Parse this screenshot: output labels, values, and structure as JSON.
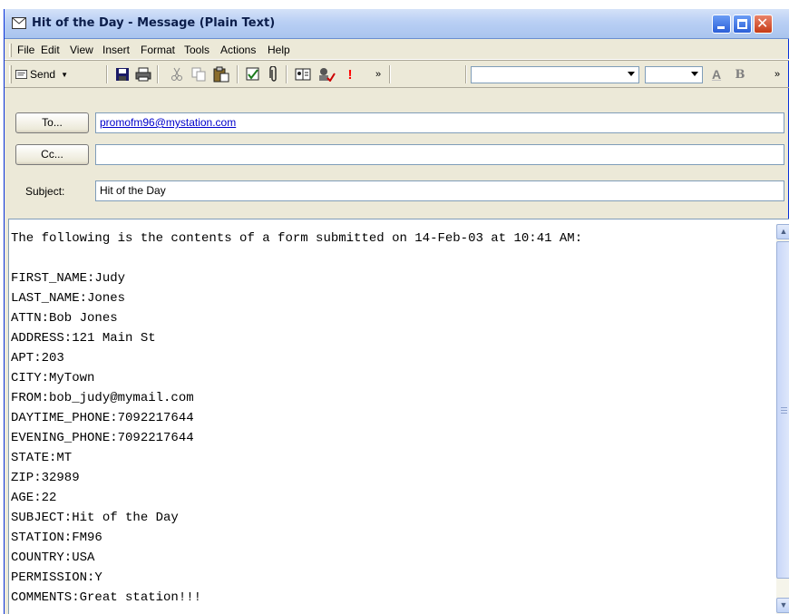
{
  "window": {
    "title": "Hit of the Day - Message (Plain Text)"
  },
  "menu": [
    {
      "label": "File"
    },
    {
      "label": "Edit"
    },
    {
      "label": "View"
    },
    {
      "label": "Insert"
    },
    {
      "label": "Format"
    },
    {
      "label": "Tools"
    },
    {
      "label": "Actions"
    },
    {
      "label": "Help"
    }
  ],
  "toolbar": {
    "send_label": "Send",
    "bold_label": "B",
    "font_color_label": "A",
    "importance_label": "!",
    "overflow_label": "»",
    "font_value": "",
    "size_value": ""
  },
  "header": {
    "to_button": "To...",
    "to_value": "promofm96@mystation.com",
    "cc_button": "Cc...",
    "cc_value": "",
    "subject_label": "Subject:",
    "subject_value": "Hit of the Day"
  },
  "body": {
    "lines": [
      "The following is the contents of a form submitted on 14-Feb-03 at 10:41 AM:",
      "",
      "FIRST_NAME:Judy",
      "LAST_NAME:Jones",
      "ATTN:Bob Jones",
      "ADDRESS:121 Main St",
      "APT:203",
      "CITY:MyTown",
      "FROM:bob_judy@mymail.com",
      "DAYTIME_PHONE:7092217644",
      "EVENING_PHONE:7092217644",
      "STATE:MT",
      "ZIP:32989",
      "AGE:22",
      "SUBJECT:Hit of the Day",
      "STATION:FM96",
      "COUNTRY:USA",
      "PERMISSION:Y",
      "COMMENTS:Great station!!!"
    ]
  },
  "colors": {
    "title_bar": "#b9cff4",
    "window_bg": "#ece9d8",
    "link": "#0000cc",
    "importance": "#ff0000"
  }
}
